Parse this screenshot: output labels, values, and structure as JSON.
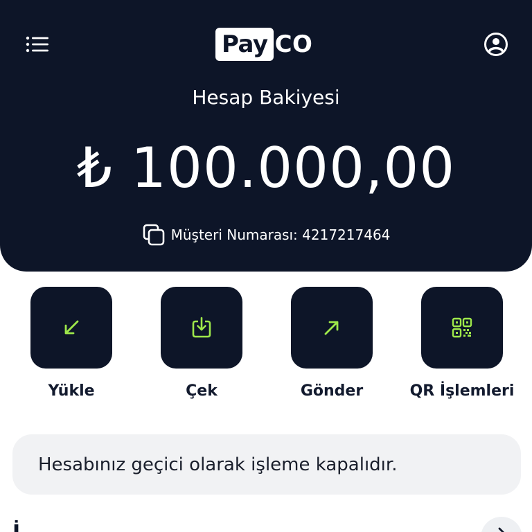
{
  "header": {
    "logo": {
      "part1": "Pay",
      "part2": "CO"
    },
    "balance_label": "Hesap Bakiyesi",
    "balance_amount": "₺ 100.000,00",
    "customer_number": "Müşteri Numarası: 4217217464"
  },
  "actions": [
    {
      "label": "Yükle",
      "icon": "arrow-down-left-icon"
    },
    {
      "label": "Çek",
      "icon": "download-tray-icon"
    },
    {
      "label": "Gönder",
      "icon": "arrow-up-right-icon"
    },
    {
      "label": "QR İşlemleri",
      "icon": "qr-code-icon"
    }
  ],
  "notice": {
    "text": "Hesabınız geçici olarak işleme kapalıdır."
  },
  "section": {
    "title": "İ..."
  },
  "colors": {
    "header_bg": "#0d1528",
    "accent": "#9ee84a",
    "notice_bg": "#f1f2f4"
  }
}
